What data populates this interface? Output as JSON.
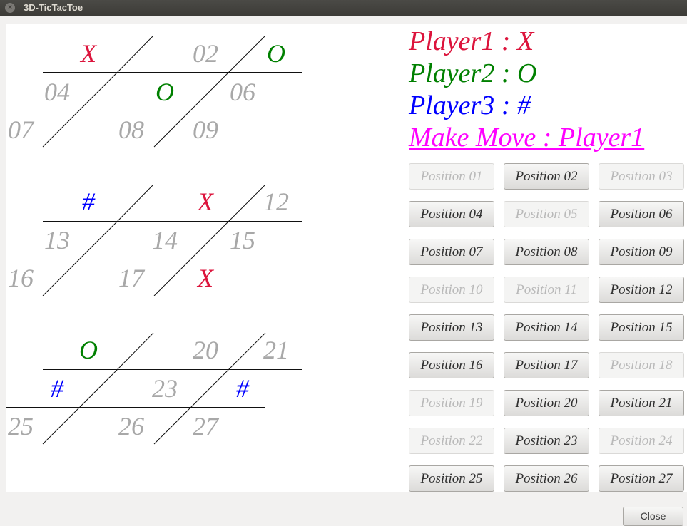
{
  "window": {
    "title": "3D-TicTacToe",
    "close_glyph": "×"
  },
  "boards": [
    {
      "cells": [
        {
          "text": "X",
          "state": "X"
        },
        {
          "text": "02",
          "state": "empty"
        },
        {
          "text": "O",
          "state": "O"
        },
        {
          "text": "04",
          "state": "empty"
        },
        {
          "text": "O",
          "state": "O"
        },
        {
          "text": "06",
          "state": "empty"
        },
        {
          "text": "07",
          "state": "empty"
        },
        {
          "text": "08",
          "state": "empty"
        },
        {
          "text": "09",
          "state": "empty"
        }
      ]
    },
    {
      "cells": [
        {
          "text": "#",
          "state": "#"
        },
        {
          "text": "X",
          "state": "X"
        },
        {
          "text": "12",
          "state": "empty"
        },
        {
          "text": "13",
          "state": "empty"
        },
        {
          "text": "14",
          "state": "empty"
        },
        {
          "text": "15",
          "state": "empty"
        },
        {
          "text": "16",
          "state": "empty"
        },
        {
          "text": "17",
          "state": "empty"
        },
        {
          "text": "X",
          "state": "X"
        }
      ]
    },
    {
      "cells": [
        {
          "text": "O",
          "state": "O"
        },
        {
          "text": "20",
          "state": "empty"
        },
        {
          "text": "21",
          "state": "empty"
        },
        {
          "text": "#",
          "state": "#"
        },
        {
          "text": "23",
          "state": "empty"
        },
        {
          "text": "#",
          "state": "#"
        },
        {
          "text": "25",
          "state": "empty"
        },
        {
          "text": "26",
          "state": "empty"
        },
        {
          "text": "27",
          "state": "empty"
        }
      ]
    }
  ],
  "info": {
    "player1": "Player1 : X",
    "player2": "Player2 : O",
    "player3": "Player3 : #",
    "make_move": "Make Move : Player1"
  },
  "colors": {
    "X": "#dc143c",
    "O": "#008000",
    "#": "#0000ff",
    "make_move": "#ff00ff",
    "empty": "#a8a8a8"
  },
  "positions": [
    {
      "label": "Position 01",
      "enabled": false
    },
    {
      "label": "Position 02",
      "enabled": true
    },
    {
      "label": "Position 03",
      "enabled": false
    },
    {
      "label": "Position 04",
      "enabled": true
    },
    {
      "label": "Position 05",
      "enabled": false
    },
    {
      "label": "Position 06",
      "enabled": true
    },
    {
      "label": "Position 07",
      "enabled": true
    },
    {
      "label": "Position 08",
      "enabled": true
    },
    {
      "label": "Position 09",
      "enabled": true
    },
    {
      "label": "Position 10",
      "enabled": false
    },
    {
      "label": "Position 11",
      "enabled": false
    },
    {
      "label": "Position 12",
      "enabled": true
    },
    {
      "label": "Position 13",
      "enabled": true
    },
    {
      "label": "Position 14",
      "enabled": true
    },
    {
      "label": "Position 15",
      "enabled": true
    },
    {
      "label": "Position 16",
      "enabled": true
    },
    {
      "label": "Position 17",
      "enabled": true
    },
    {
      "label": "Position 18",
      "enabled": false
    },
    {
      "label": "Position 19",
      "enabled": false
    },
    {
      "label": "Position 20",
      "enabled": true
    },
    {
      "label": "Position 21",
      "enabled": true
    },
    {
      "label": "Position 22",
      "enabled": false
    },
    {
      "label": "Position 23",
      "enabled": true
    },
    {
      "label": "Position 24",
      "enabled": false
    },
    {
      "label": "Position 25",
      "enabled": true
    },
    {
      "label": "Position 26",
      "enabled": true
    },
    {
      "label": "Position 27",
      "enabled": true
    }
  ],
  "footer": {
    "close_label": "Close"
  }
}
